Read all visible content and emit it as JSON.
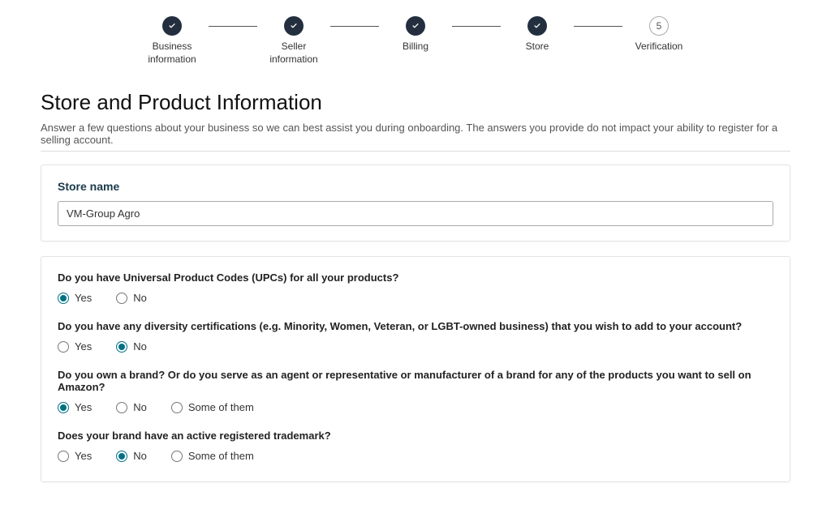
{
  "stepper": {
    "steps": [
      {
        "label": "Business information",
        "done": true
      },
      {
        "label": "Seller information",
        "done": true
      },
      {
        "label": "Billing",
        "done": true
      },
      {
        "label": "Store",
        "done": true
      },
      {
        "label": "Verification",
        "done": false,
        "number": "5"
      }
    ]
  },
  "page": {
    "title": "Store and Product Information",
    "subtitle": "Answer a few questions about your business so we can best assist you during onboarding. The answers you provide do not impact your ability to register for a selling account."
  },
  "store": {
    "label": "Store name",
    "value": "VM-Group Agro"
  },
  "questions": {
    "q1": {
      "label": "Do you have Universal Product Codes (UPCs) for all your products?",
      "options": {
        "yes": "Yes",
        "no": "No"
      },
      "selected": "yes"
    },
    "q2": {
      "label": "Do you have any diversity certifications (e.g. Minority, Women, Veteran, or LGBT-owned business) that you wish to add to your account?",
      "options": {
        "yes": "Yes",
        "no": "No"
      },
      "selected": "no"
    },
    "q3": {
      "label": "Do you own a brand? Or do you serve as an agent or representative or manufacturer of a brand for any of the products you want to sell on Amazon?",
      "options": {
        "yes": "Yes",
        "no": "No",
        "some": "Some of them"
      },
      "selected": "yes"
    },
    "q4": {
      "label": "Does your brand have an active registered trademark?",
      "options": {
        "yes": "Yes",
        "no": "No",
        "some": "Some of them"
      },
      "selected": "no"
    }
  }
}
